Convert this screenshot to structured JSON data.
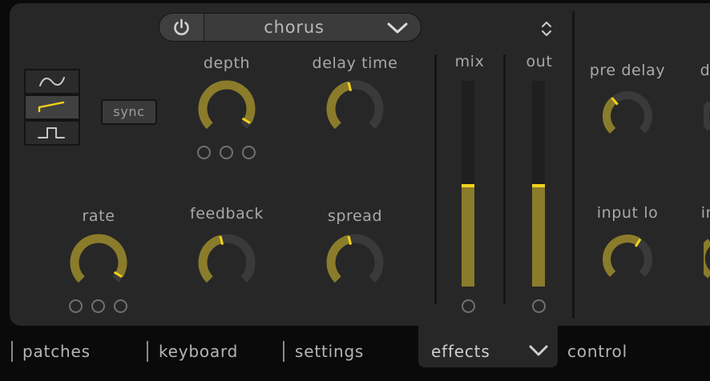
{
  "effect_selector": {
    "name": "chorus",
    "power_icon": "power-icon",
    "dropdown_icon": "chevron-down-icon"
  },
  "header": {
    "sort_icon": "up-down-arrows-icon"
  },
  "lfo": {
    "waveforms": [
      {
        "name": "sine-wave-icon",
        "selected": false
      },
      {
        "name": "saw-wave-icon",
        "selected": true
      },
      {
        "name": "square-wave-icon",
        "selected": false
      }
    ],
    "sync_label": "sync"
  },
  "knobs": {
    "depth": {
      "label": "depth",
      "value": 0.95
    },
    "delay_time": {
      "label": "delay time",
      "value": 0.45
    },
    "rate": {
      "label": "rate",
      "value": 0.95
    },
    "feedback": {
      "label": "feedback",
      "value": 0.45
    },
    "spread": {
      "label": "spread",
      "value": 0.45
    },
    "pre_delay": {
      "label": "pre delay",
      "value": 0.35
    },
    "input_lo": {
      "label": "input lo",
      "value": 0.62
    },
    "partial_top_label": "d",
    "partial_bottom_label": "in"
  },
  "meters": {
    "mix": {
      "label": "mix",
      "level": 0.5
    },
    "out": {
      "label": "out",
      "level": 0.5
    }
  },
  "tabs": [
    {
      "label": "patches",
      "active": false
    },
    {
      "label": "keyboard",
      "active": false
    },
    {
      "label": "settings",
      "active": false
    },
    {
      "label": "effects",
      "active": true
    },
    {
      "label": "control",
      "active": false
    }
  ],
  "colors": {
    "accent": "#f1d21c",
    "knob_fill": "#8b7c2b",
    "knob_track": "#3a3a3a",
    "panel": "#272727",
    "background": "#0a0a0a"
  }
}
